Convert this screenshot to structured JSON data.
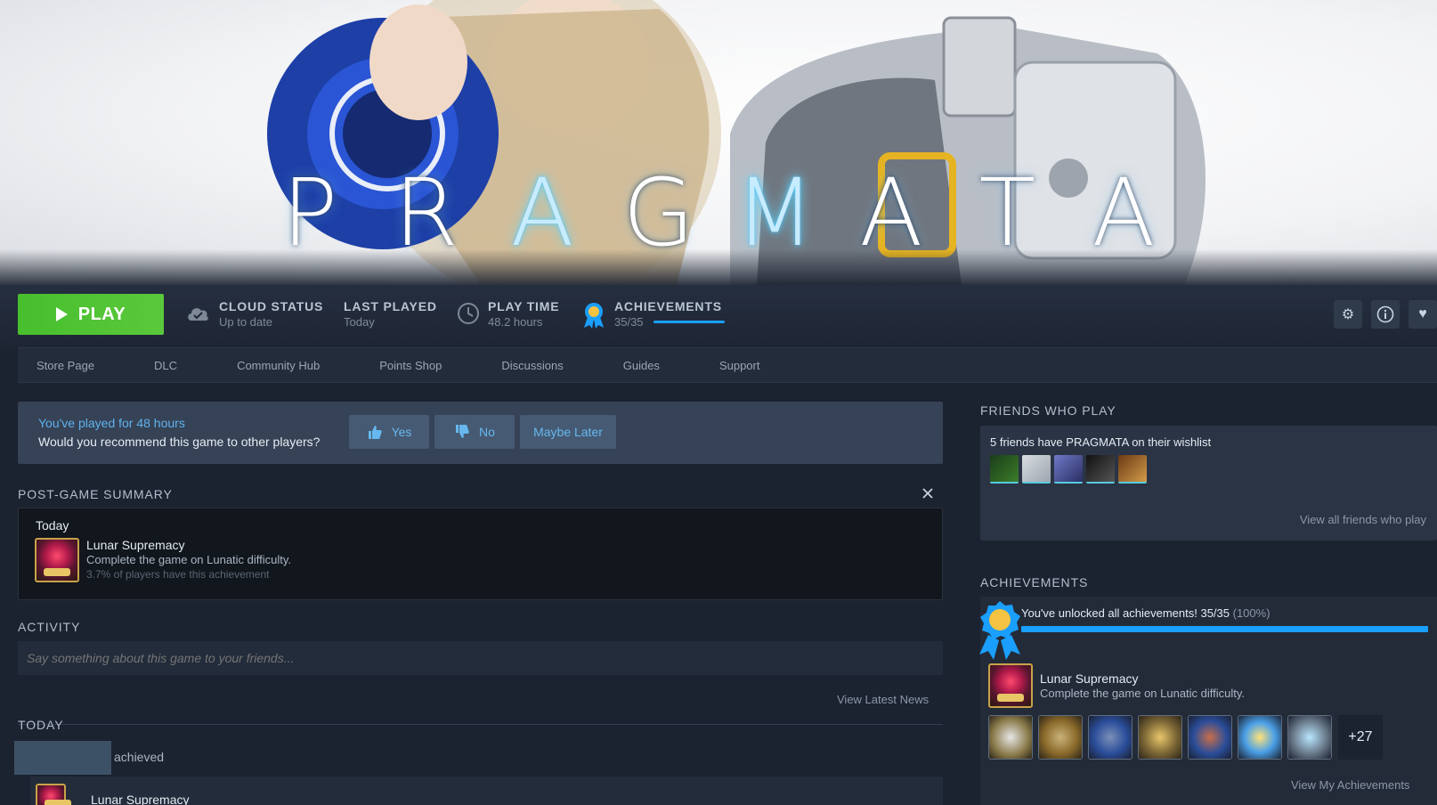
{
  "hero": {
    "logo_letters": [
      "P",
      "R",
      "A",
      "G",
      "M",
      "A",
      "T",
      "A"
    ]
  },
  "playbar": {
    "play_label": "PLAY",
    "cloud_status": {
      "label": "CLOUD STATUS",
      "value": "Up to date"
    },
    "last_played": {
      "label": "LAST PLAYED",
      "value": "Today"
    },
    "play_time": {
      "label": "PLAY TIME",
      "value": "48.2 hours"
    },
    "achievements": {
      "label": "ACHIEVEMENTS",
      "value": "35/35",
      "progress": 1.0
    }
  },
  "nav": {
    "items": [
      "Store Page",
      "DLC",
      "Community Hub",
      "Points Shop",
      "Discussions",
      "Guides",
      "Support"
    ]
  },
  "recommend": {
    "line1": "You've played for 48 hours",
    "line2": "Would you recommend this game to other players?",
    "yes": "Yes",
    "no": "No",
    "later": "Maybe Later"
  },
  "summary": {
    "header": "POST-GAME SUMMARY",
    "day": "Today",
    "achievement_title": "Lunar Supremacy",
    "achievement_desc": "Complete the game on Lunatic difficulty.",
    "achievement_rarity": "3.7% of players have this achievement"
  },
  "activity": {
    "header": "ACTIVITY",
    "placeholder": "Say something about this game to your friends...",
    "view_news": "View Latest News",
    "today": "TODAY",
    "achieved": "achieved",
    "item_title": "Lunar Supremacy"
  },
  "friends": {
    "header": "FRIENDS WHO PLAY",
    "wishlist_text": "5 friends have PRAGMATA on their wishlist",
    "view_all": "View all friends who play"
  },
  "achievements_panel": {
    "header": "ACHIEVEMENTS",
    "unlocked_text": "You've unlocked all achievements! 35/35",
    "unlocked_pct": "(100%)",
    "progress": 1.0,
    "featured_title": "Lunar Supremacy",
    "featured_desc": "Complete the game on Lunatic difficulty.",
    "more_count": "+27",
    "view_mine": "View My Achievements"
  },
  "colors": {
    "play_green": "#47bf2d",
    "accent_blue": "#1a9fff",
    "link_blue": "#5fb2ef"
  }
}
